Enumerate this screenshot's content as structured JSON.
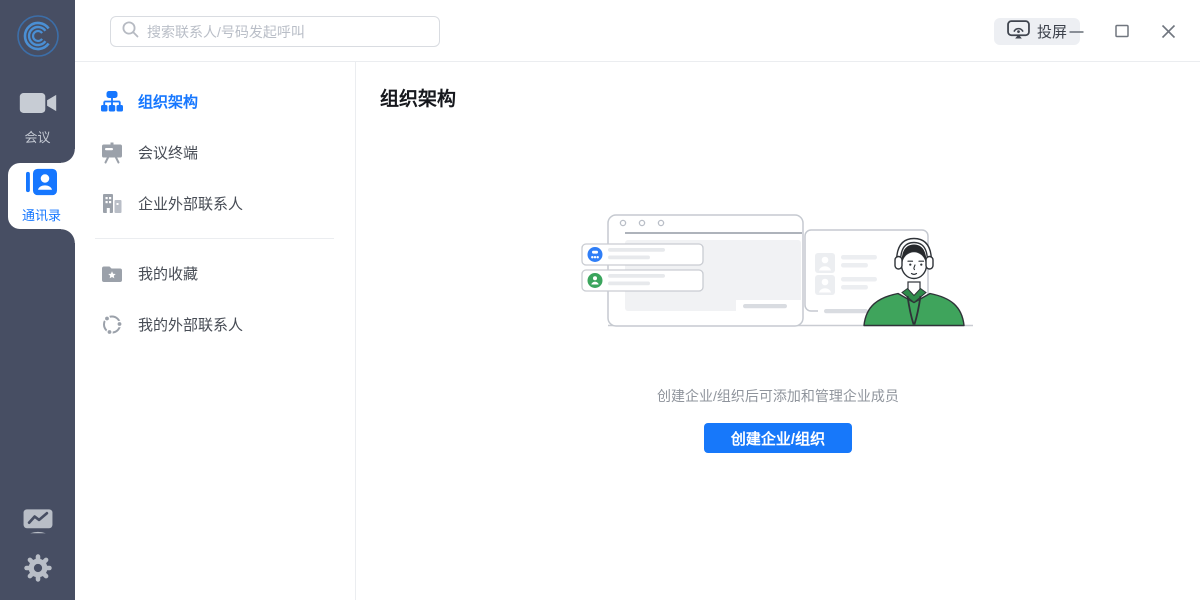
{
  "colors": {
    "accent": "#1677ff",
    "rail_bg": "#474e63",
    "button_bg": "#1778fa",
    "green": "#3ba55d"
  },
  "rail": {
    "logo_icon": "c-rings-logo",
    "items": [
      {
        "icon": "video-camera-icon",
        "label": "会议",
        "selected": false
      },
      {
        "icon": "contacts-book-icon",
        "label": "通讯录",
        "selected": true
      }
    ],
    "bottom_icons": [
      "stats-monitor-icon",
      "settings-gear-icon"
    ]
  },
  "topbar": {
    "search": {
      "icon": "search-icon",
      "placeholder": "搜索联系人/号码发起呼叫",
      "value": ""
    },
    "cast_button": {
      "icon": "cast-screen-icon",
      "label": "投屏"
    },
    "window_controls": [
      "minimize-icon",
      "maximize-icon",
      "close-icon"
    ]
  },
  "sidebar": {
    "sections": [
      {
        "items": [
          {
            "icon": "org-chart-icon",
            "label": "组织架构",
            "selected": true
          },
          {
            "icon": "meeting-terminal-icon",
            "label": "会议终端",
            "selected": false
          },
          {
            "icon": "buildings-icon",
            "label": "企业外部联系人",
            "selected": false
          }
        ]
      },
      {
        "items": [
          {
            "icon": "folder-star-icon",
            "label": "我的收藏",
            "selected": false
          },
          {
            "icon": "network-contacts-icon",
            "label": "我的外部联系人",
            "selected": false
          }
        ]
      }
    ]
  },
  "main": {
    "title": "组织架构",
    "empty_state": {
      "illustration": "org-empty-illustration",
      "hint": "创建企业/组织后可添加和管理企业成员",
      "button_label": "创建企业/组织"
    }
  }
}
